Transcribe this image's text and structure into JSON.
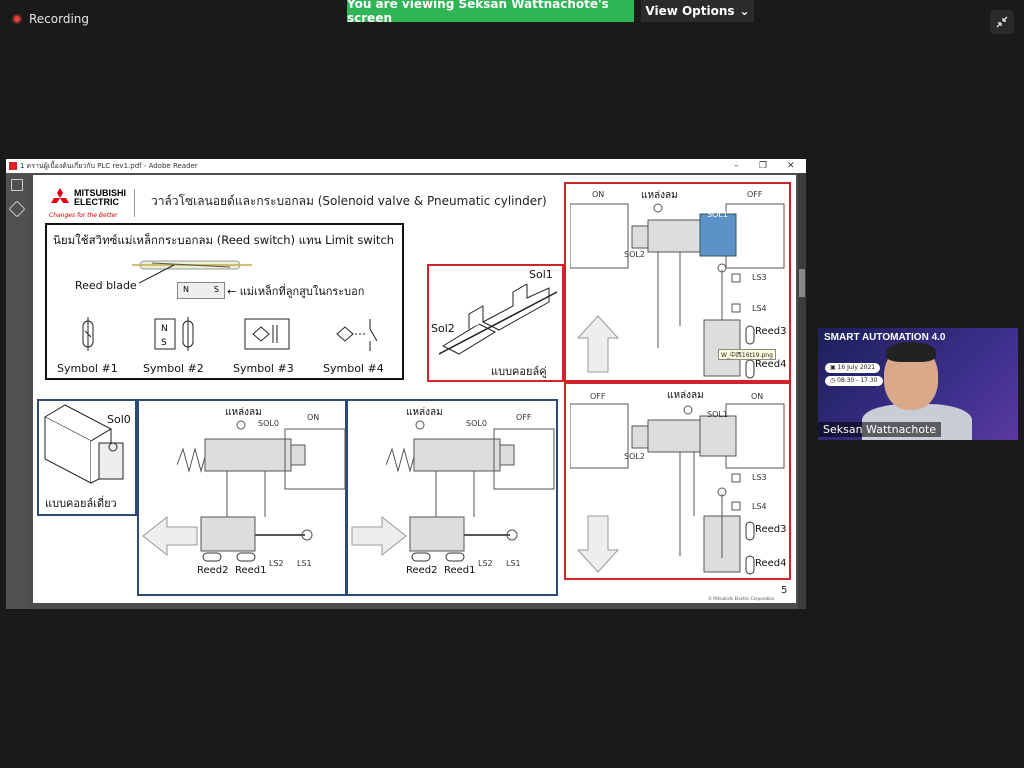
{
  "meeting": {
    "recording_label": "Recording",
    "viewing_banner": "You are viewing Seksan Wattnachote's screen",
    "view_options_label": "View Options"
  },
  "reader": {
    "window_title": "1 ตรานผู้เบื้องต้นเกี่ยวกับ PLC rev1.pdf - Adobe Reader",
    "minimize": "–",
    "restore": "❐",
    "close": "✕"
  },
  "slide": {
    "brand_line1": "MITSUBISHI",
    "brand_line2": "ELECTRIC",
    "brand_tagline": "Changes for the Better",
    "title": "วาล์วโซเลนอยด์และกระบอกลม (Solenoid valve & Pneumatic cylinder)",
    "reed_box": {
      "heading": "นิยมใช้สวิทซ์แม่เหล็กกระบอกลม (Reed switch) แทน Limit switch",
      "reed_blade": "Reed blade",
      "magnet_n": "N",
      "magnet_s": "S",
      "magnet_label": "แม่เหล็กที่ลูกสูบในกระบอก",
      "symbols": [
        "Symbol #1",
        "Symbol #2",
        "Symbol #3",
        "Symbol #4"
      ]
    },
    "double_coil": {
      "sol1": "Sol1",
      "sol2": "Sol2",
      "caption": "แบบคอยล์คู่"
    },
    "single_coil": {
      "sol0": "Sol0",
      "caption": "แบบคอยล์เดี่ยว"
    },
    "circuit_left": {
      "air_source": "แหล่งลม",
      "sol0": "SOL0",
      "switch_state": "ON",
      "reed2": "Reed2",
      "reed1": "Reed1",
      "ls2": "LS2",
      "ls1": "LS1"
    },
    "circuit_mid": {
      "air_source": "แหล่งลม",
      "sol0": "SOL0",
      "switch_state": "OFF",
      "reed2": "Reed2",
      "reed1": "Reed1",
      "ls2": "LS2",
      "ls1": "LS1"
    },
    "circuit_top_right": {
      "left_switch": "ON",
      "air_source": "แหล่งลม",
      "right_switch": "OFF",
      "sol1": "SOL1",
      "sol2": "SOL2",
      "ls3": "LS3",
      "ls4": "LS4",
      "reed3": "Reed3",
      "reed4": "Reed4",
      "tooltip": "W_中西16t19.png"
    },
    "circuit_bottom_right": {
      "left_switch": "OFF",
      "air_source": "แหล่งลม",
      "right_switch": "ON",
      "sol1": "SOL1",
      "sol2": "SOL2",
      "ls3": "LS3",
      "ls4": "LS4",
      "reed3": "Reed3",
      "reed4": "Reed4"
    },
    "page_number": "5",
    "copyright": "© Mitsubishi Electric Corporation"
  },
  "camera": {
    "event_title": "SMART AUTOMATION 4.0",
    "date_text": "16 July 2021",
    "time_text": "08.30 - 17.30",
    "participant_name": "Seksan Wattnachote"
  },
  "colors": {
    "banner_green": "#2fb556",
    "frame_red": "#d1232a",
    "frame_blue": "#2d4a78",
    "solenoid_blue": "#5b93c8"
  }
}
